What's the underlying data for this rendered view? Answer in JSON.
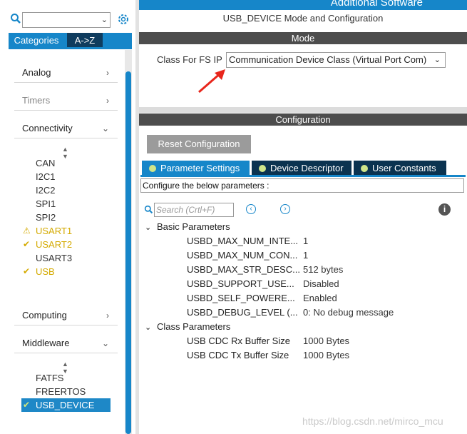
{
  "left": {
    "tabs": {
      "categories": "Categories",
      "az": "A->Z"
    },
    "categories": [
      {
        "label": "Analog",
        "chev": ">"
      },
      {
        "label": "Timers",
        "chev": ">"
      },
      {
        "label": "Connectivity",
        "chev": "v"
      },
      {
        "label": "Computing",
        "chev": ">"
      },
      {
        "label": "Middleware",
        "chev": "v"
      }
    ],
    "connectivity_items": [
      "CAN",
      "I2C1",
      "I2C2",
      "SPI1",
      "SPI2",
      "USART1",
      "USART2",
      "USART3",
      "USB"
    ],
    "middleware_items": [
      "FATFS",
      "FREERTOS",
      "USB_DEVICE"
    ]
  },
  "header": {
    "additional_software": "Additional Software"
  },
  "title": "USB_DEVICE Mode and Configuration",
  "mode": {
    "bar_label": "Mode",
    "class_label": "Class For FS IP",
    "class_value": "Communication Device Class (Virtual Port Com)"
  },
  "configuration": {
    "bar_label": "Configuration",
    "reset_label": "Reset Configuration",
    "tabs": [
      "Parameter Settings",
      "Device Descriptor",
      "User Constants"
    ],
    "configure_text": "Configure the below parameters :",
    "search_placeholder": "Search (Crtl+F)"
  },
  "groups": [
    {
      "name": "Basic Parameters",
      "params": [
        {
          "name": "USBD_MAX_NUM_INTE...",
          "value": "1"
        },
        {
          "name": "USBD_MAX_NUM_CON...",
          "value": "1"
        },
        {
          "name": "USBD_MAX_STR_DESC...",
          "value": "512 bytes"
        },
        {
          "name": "USBD_SUPPORT_USE...",
          "value": "Disabled"
        },
        {
          "name": "USBD_SELF_POWERE...",
          "value": "Enabled"
        },
        {
          "name": "USBD_DEBUG_LEVEL (...",
          "value": "0: No debug message"
        }
      ]
    },
    {
      "name": "Class Parameters",
      "params": [
        {
          "name": "USB CDC Rx Buffer Size",
          "value": "1000 Bytes"
        },
        {
          "name": "USB CDC Tx Buffer Size",
          "value": "1000 Bytes"
        }
      ]
    }
  ],
  "watermark": "https://blog.csdn.net/mirco_mcu",
  "colors": {
    "accent": "#1686c9",
    "dark_tab": "#0b3350",
    "bar": "#4d4d4d",
    "warn": "#d4aa00"
  }
}
